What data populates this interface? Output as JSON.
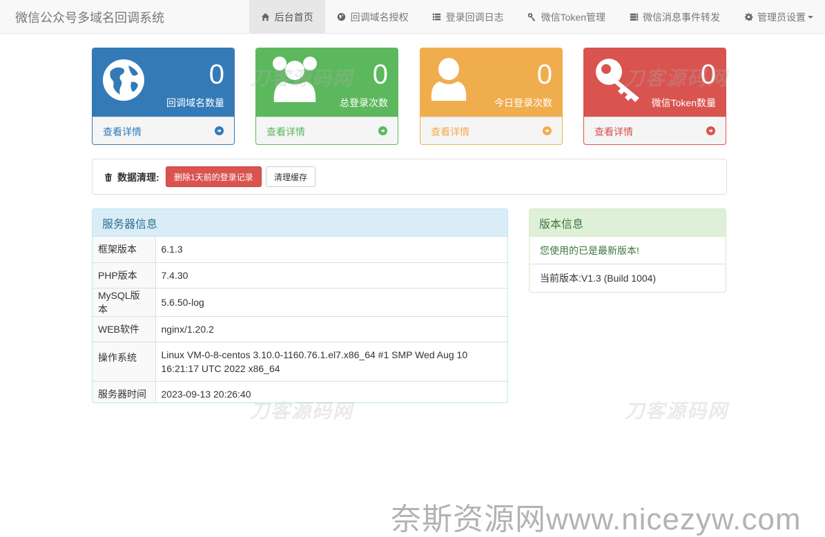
{
  "navbar": {
    "brand": "微信公众号多域名回调系统",
    "items": [
      {
        "label": "后台首页",
        "icon": "home-icon",
        "active": true
      },
      {
        "label": "回调域名授权",
        "icon": "globe-icon"
      },
      {
        "label": "登录回调日志",
        "icon": "list-icon"
      },
      {
        "label": "微信Token管理",
        "icon": "key-icon"
      },
      {
        "label": "微信消息事件转发",
        "icon": "server-icon"
      },
      {
        "label": "管理员设置",
        "icon": "gear-icon",
        "dropdown": true
      }
    ]
  },
  "stats": [
    {
      "value": "0",
      "label": "回调域名数量",
      "link": "查看详情",
      "color": "#337ab7",
      "icon": "globe-icon"
    },
    {
      "value": "0",
      "label": "总登录次数",
      "link": "查看详情",
      "color": "#5cb85c",
      "icon": "users-icon"
    },
    {
      "value": "0",
      "label": "今日登录次数",
      "link": "查看详情",
      "color": "#f0ad4e",
      "icon": "user-icon"
    },
    {
      "value": "0",
      "label": "微信Token数量",
      "link": "查看详情",
      "color": "#d9534f",
      "icon": "key-icon"
    }
  ],
  "cleanup": {
    "label": "数据清理:",
    "delete_button": "删除1天前的登录记录",
    "clear_cache_button": "清理缓存"
  },
  "server": {
    "title": "服务器信息",
    "rows": [
      {
        "key": "框架版本",
        "value": "6.1.3"
      },
      {
        "key": "PHP版本",
        "value": "7.4.30"
      },
      {
        "key": "MySQL版本",
        "value": "5.6.50-log"
      },
      {
        "key": "WEB软件",
        "value": "nginx/1.20.2"
      },
      {
        "key": "操作系统",
        "value": "Linux VM-0-8-centos 3.10.0-1160.76.1.el7.x86_64 #1 SMP Wed Aug 10 16:21:17 UTC 2022 x86_64"
      },
      {
        "key": "服务器时间",
        "value": "2023-09-13 20:26:40"
      }
    ]
  },
  "version": {
    "title": "版本信息",
    "status": "您使用的已是最新版本!",
    "current": "当前版本:V1.3 (Build 1004)"
  },
  "watermarks": {
    "site": "刀客源码网",
    "footer": "奈斯资源网www.nicezyw.com"
  }
}
